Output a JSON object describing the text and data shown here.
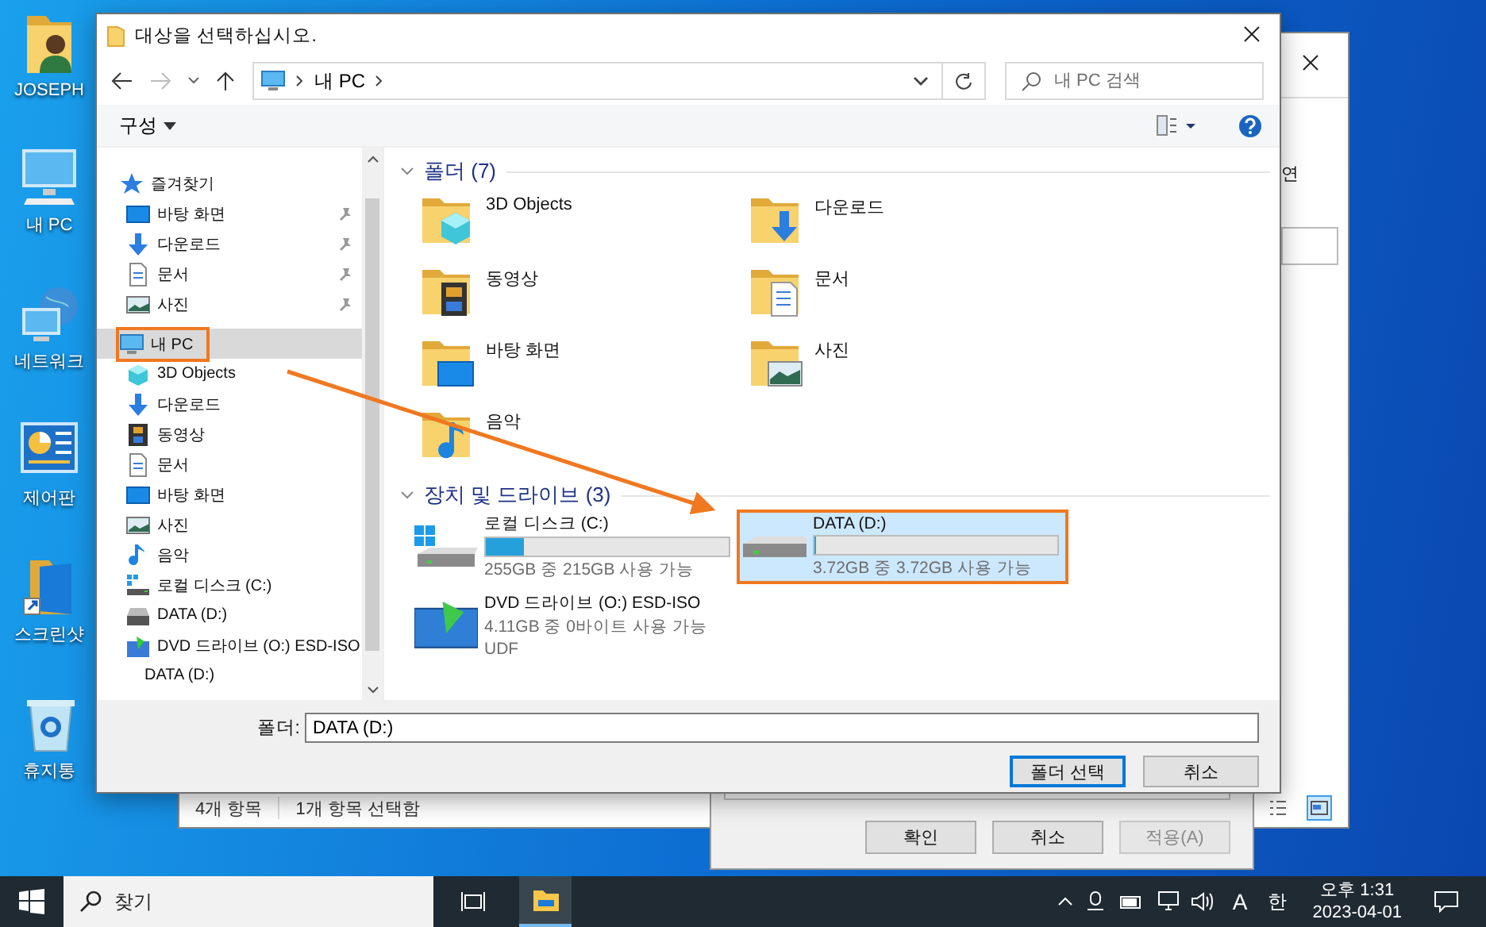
{
  "desktop_icons": [
    {
      "label": "JOSEPH",
      "kind": "user"
    },
    {
      "label": "내 PC",
      "kind": "pc"
    },
    {
      "label": "네트워크",
      "kind": "network"
    },
    {
      "label": "제어판",
      "kind": "control"
    },
    {
      "label": "스크린샷",
      "kind": "shortcut"
    },
    {
      "label": "휴지통",
      "kind": "bin"
    }
  ],
  "back_window": {
    "tab_fragment": "연",
    "status": [
      "4개 항목",
      "1개 항목 선택함"
    ],
    "views": [
      {
        "kind": "details",
        "selected": false
      },
      {
        "kind": "tiles",
        "selected": true
      }
    ]
  },
  "properties_dialog": {
    "buttons": [
      {
        "label": "확인",
        "disabled": false
      },
      {
        "label": "취소",
        "disabled": false
      },
      {
        "label": "적용(A)",
        "disabled": true
      }
    ]
  },
  "dialog": {
    "title": "대상을 선택하십시오.",
    "breadcrumb": [
      "내 PC"
    ],
    "search": {
      "placeholder": "내 PC 검색"
    },
    "organize": "구성",
    "nav": [
      {
        "label": "즐겨찾기",
        "kind": "star",
        "selected": false,
        "highlighted": false,
        "children": [
          {
            "label": "바탕 화면",
            "kind": "desktop",
            "pinned": true,
            "selected": false,
            "highlighted": false
          },
          {
            "label": "다운로드",
            "kind": "download",
            "pinned": true,
            "selected": false,
            "highlighted": false
          },
          {
            "label": "문서",
            "kind": "document",
            "pinned": true,
            "selected": false,
            "highlighted": false
          },
          {
            "label": "사진",
            "kind": "picture",
            "pinned": true,
            "selected": false,
            "highlighted": false
          }
        ]
      },
      {
        "label": "내 PC",
        "kind": "pc",
        "selected": true,
        "highlighted": true,
        "children": [
          {
            "label": "3D Objects",
            "kind": "cube",
            "selected": false,
            "highlighted": false
          },
          {
            "label": "다운로드",
            "kind": "download",
            "selected": false,
            "highlighted": false
          },
          {
            "label": "동영상",
            "kind": "video",
            "selected": false,
            "highlighted": false
          },
          {
            "label": "문서",
            "kind": "document",
            "selected": false,
            "highlighted": false
          },
          {
            "label": "바탕 화면",
            "kind": "desktop",
            "selected": false,
            "highlighted": false
          },
          {
            "label": "사진",
            "kind": "picture",
            "selected": false,
            "highlighted": false
          },
          {
            "label": "음악",
            "kind": "music",
            "selected": false,
            "highlighted": false
          },
          {
            "label": "로컬 디스크 (C:)",
            "kind": "disk",
            "selected": false,
            "highlighted": false
          },
          {
            "label": "DATA (D:)",
            "kind": "drive",
            "selected": false,
            "highlighted": false
          },
          {
            "label": "DVD 드라이브 (O:) ESD-ISO",
            "kind": "dvd",
            "selected": false,
            "highlighted": false
          }
        ]
      },
      {
        "label": "DATA (D:)",
        "kind": "plain",
        "selected": false,
        "highlighted": false
      }
    ],
    "folders_header": "폴더 (7)",
    "folders": [
      {
        "label": "3D Objects",
        "kind": "cube"
      },
      {
        "label": "다운로드",
        "kind": "download"
      },
      {
        "label": "동영상",
        "kind": "video"
      },
      {
        "label": "문서",
        "kind": "document"
      },
      {
        "label": "바탕 화면",
        "kind": "desktop"
      },
      {
        "label": "사진",
        "kind": "picture"
      },
      {
        "label": "음악",
        "kind": "music"
      }
    ],
    "drives_header": "장치 및 드라이브 (3)",
    "drives": [
      {
        "name": "로컬 디스크 (C:)",
        "kind": "disk",
        "level": 0.16,
        "lines": [
          "255GB 중 215GB 사용 가능"
        ],
        "selected": false,
        "highlighted": false
      },
      {
        "name": "DATA (D:)",
        "kind": "drive",
        "level": 0,
        "lines": [
          "3.72GB 중 3.72GB 사용 가능"
        ],
        "selected": true,
        "highlighted": true
      },
      {
        "name": "DVD 드라이브 (O:) ESD-ISO",
        "kind": "dvd",
        "lines": [
          "4.11GB 중 0바이트 사용 가능",
          "UDF"
        ],
        "selected": false,
        "highlighted": false
      }
    ],
    "folder_label": "폴더:",
    "folder_value": "DATA (D:)",
    "buttons": [
      {
        "label": "폴더 선택",
        "default": true
      },
      {
        "label": "취소",
        "default": false
      }
    ]
  },
  "taskbar": {
    "search_placeholder": "찾기",
    "ime_mode": "A",
    "ime_lang": "한",
    "time": "오후 1:31",
    "date": "2023-04-01"
  }
}
